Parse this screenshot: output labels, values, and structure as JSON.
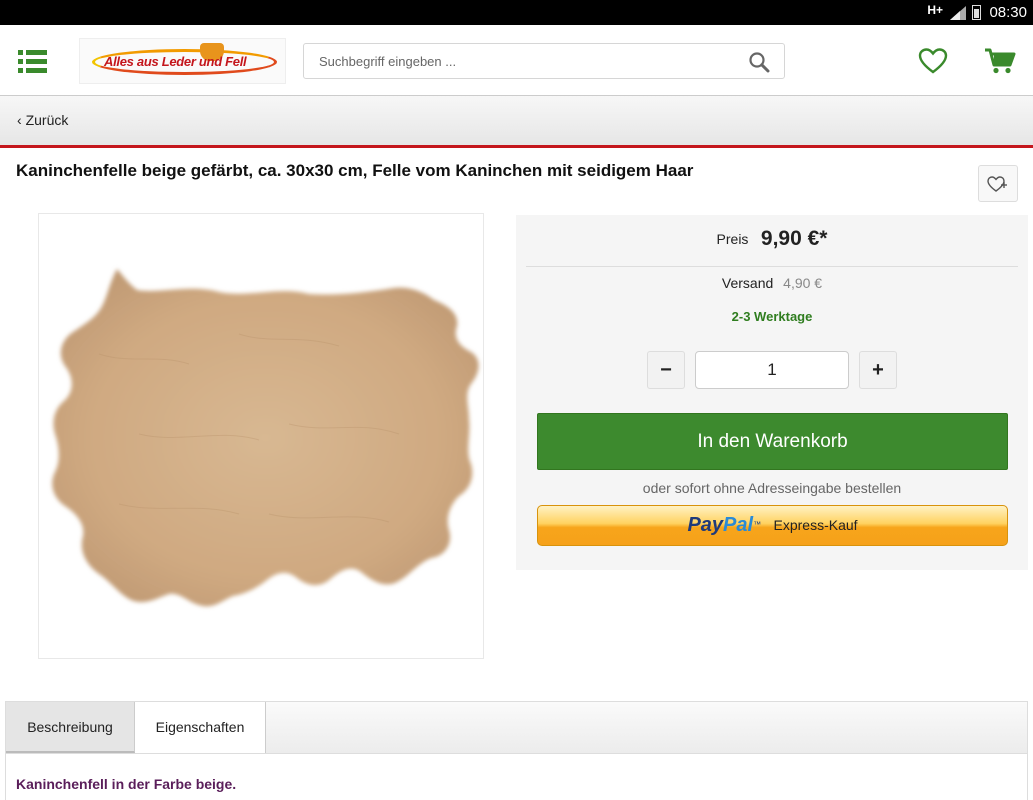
{
  "status_bar": {
    "network": "H+",
    "time": "08:30"
  },
  "header": {
    "logo_text": "Alles aus Leder und Fell",
    "search": {
      "placeholder": "Suchbegriff eingeben ..."
    }
  },
  "nav": {
    "back_label": "Zurück"
  },
  "product": {
    "title": "Kaninchenfelle beige gefärbt, ca. 30x30 cm, Felle vom Kaninchen mit seidigem Haar",
    "price_label": "Preis",
    "price_value": "9,90 €*",
    "shipping_label": "Versand",
    "shipping_value": "4,90 €",
    "delivery_time": "2-3 Werktage",
    "quantity": "1",
    "minus_label": "−",
    "plus_label": "+",
    "add_to_cart_label": "In den Warenkorb",
    "express_note": "oder sofort ohne Adresseingabe bestellen",
    "paypal": {
      "pay": "Pay",
      "pal": "Pal",
      "tm": "™",
      "text": "Express-Kauf"
    }
  },
  "tabs": [
    {
      "label": "Beschreibung"
    },
    {
      "label": "Eigenschaften"
    }
  ],
  "description": {
    "text": "Kaninchenfell in der Farbe beige."
  },
  "colors": {
    "brand_green": "#3d8a2e",
    "accent_red": "#c4161c",
    "delivery_green": "#2f7d1f",
    "description_purple": "#5a1e5a",
    "fur_beige": "#d4b38c"
  }
}
